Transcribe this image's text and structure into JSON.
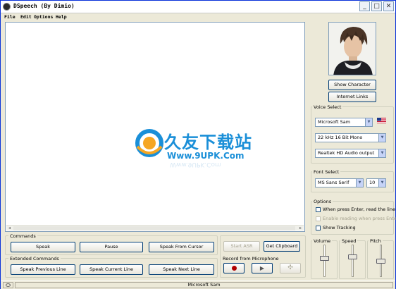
{
  "window": {
    "title": "DSpeech (By Dimio)",
    "min_icon": "minimize-icon",
    "max_icon": "maximize-icon",
    "close_icon": "close-icon"
  },
  "menu": [
    "File",
    "Edit",
    "Options",
    "Help"
  ],
  "editor": {
    "text": "",
    "watermark": {
      "cn": "久友下载站",
      "url": "Www.9UPK.Com",
      "reflection": "Www.9UPK.Com"
    }
  },
  "commands": {
    "label": "Commands",
    "speak": "Speak",
    "pause": "Pause",
    "speak_from_cursor": "Speak From Cursor"
  },
  "extended": {
    "label": "Extended Commands",
    "prev": "Speak Previous Line",
    "current": "Speak Current Line",
    "next": "Speak Next Line"
  },
  "asr": {
    "start": "Start ASR",
    "get_clipboard": "Get Clipboard",
    "record_label": "Record from Microphone"
  },
  "character": {
    "show": "Show Character",
    "internet_links": "Internet Links"
  },
  "voice_select": {
    "label": "Voice Select",
    "voice": "Microsoft Sam",
    "format": "22 kHz 16 Bit Mono",
    "output": "Realtek HD Audio output"
  },
  "font_select": {
    "label": "Font Select",
    "font": "MS Sans Serif",
    "size": "10"
  },
  "options": {
    "label": "Options",
    "items": [
      {
        "label": "When press Enter, read the line",
        "checked": false,
        "enabled": true
      },
      {
        "label": "Enable reading when press Enter",
        "checked": false,
        "enabled": false
      },
      {
        "label": "Show Tracking",
        "checked": false,
        "enabled": true
      }
    ]
  },
  "sliders": {
    "volume": {
      "label": "Volume",
      "level": 0.6
    },
    "speed": {
      "label": "Speed",
      "level": 0.65
    },
    "pitch": {
      "label": "Pitch",
      "level": 0.5
    }
  },
  "status": {
    "voice": "Microsoft Sam"
  },
  "colors": {
    "accent": "#1a8fd8",
    "record": "#b00000"
  }
}
